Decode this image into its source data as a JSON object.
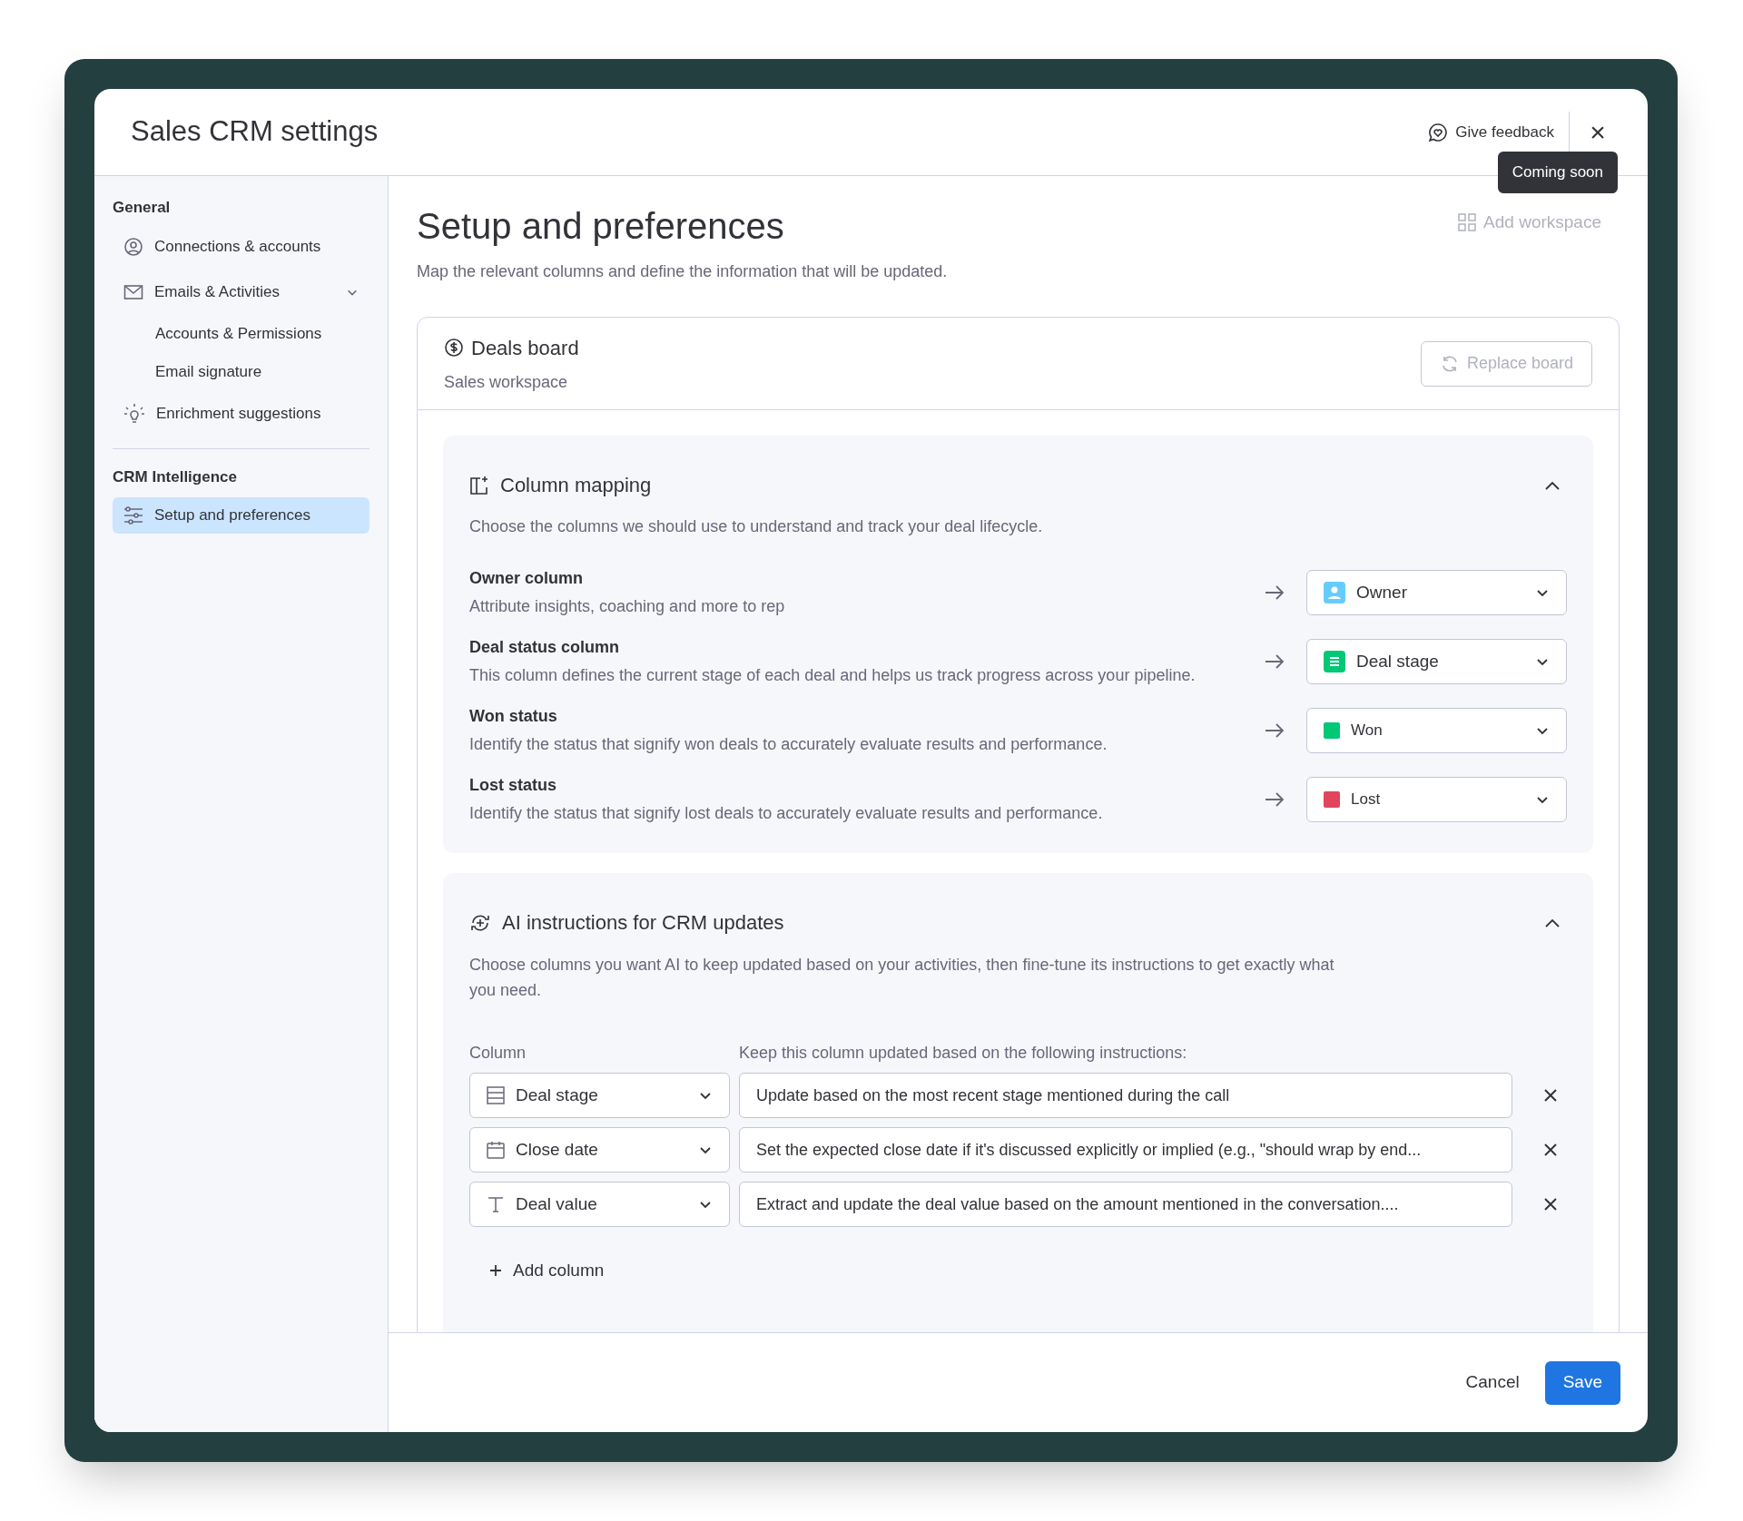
{
  "window": {
    "title": "Sales CRM settings",
    "feedback": "Give feedback",
    "close": "×"
  },
  "sidebar": {
    "sections": [
      {
        "title": "General",
        "items": [
          {
            "label": "Connections & accounts",
            "selected": false
          },
          {
            "label": "Emails & Activities",
            "selected": false,
            "expanded": true,
            "children": [
              {
                "label": "Accounts & Permissions",
                "selected": false
              },
              {
                "label": "Email signature",
                "selected": false
              }
            ]
          },
          {
            "label": "Enrichment suggestions",
            "selected": false
          }
        ]
      },
      {
        "title": "CRM Intelligence",
        "items": [
          {
            "label": "Setup and preferences",
            "selected": true
          }
        ]
      }
    ]
  },
  "page": {
    "title": "Setup and preferences",
    "subtitle": "Map the relevant columns and define the information that will be updated.",
    "add_workspace": {
      "label": "Add workspace",
      "disabled": true,
      "tooltip": "Coming soon"
    }
  },
  "board": {
    "name": "Deals board",
    "workspace": "Sales workspace",
    "replace_button": {
      "label": "Replace board",
      "disabled": true
    }
  },
  "column_mapping": {
    "title": "Column mapping",
    "expanded": true,
    "description": "Choose the columns we should use to understand and track your deal lifecycle.",
    "rows": [
      {
        "label": "Owner column",
        "description": "Attribute insights, coaching and more to rep",
        "value": "Owner",
        "kind": "people",
        "color": "#66ccff"
      },
      {
        "label": "Deal status column",
        "description": "This column defines the current stage of each deal and helps us track progress across your pipeline.",
        "value": "Deal stage",
        "kind": "status",
        "color": "#00c875"
      },
      {
        "label": "Won status",
        "description": "Identify the status that signify won deals to accurately evaluate results and performance.",
        "value": "Won",
        "kind": "label",
        "color": "#00c875"
      },
      {
        "label": "Lost status",
        "description": "Identify the status that signify lost deals to accurately evaluate results and performance.",
        "value": "Lost",
        "kind": "label",
        "color": "#e2445c"
      }
    ]
  },
  "ai_instructions": {
    "title": "AI instructions for CRM updates",
    "expanded": true,
    "description": "Choose columns you want AI to keep updated based on your activities, then fine-tune its instructions to get exactly what you need.",
    "column_header": "Column",
    "instructions_header": "Keep this column updated based on the following instructions:",
    "rows": [
      {
        "column": "Deal stage",
        "kind": "status",
        "instruction": "Update based on the most recent stage mentioned during the call"
      },
      {
        "column": "Close date",
        "kind": "date",
        "instruction": "Set the expected close date if it's discussed explicitly or implied (e.g., \"should wrap by end..."
      },
      {
        "column": "Deal value",
        "kind": "text",
        "instruction": "Extract and update the deal value based on the amount mentioned in the conversation...."
      }
    ],
    "add_column": "Add column"
  },
  "footer": {
    "cancel": "Cancel",
    "save": "Save"
  }
}
